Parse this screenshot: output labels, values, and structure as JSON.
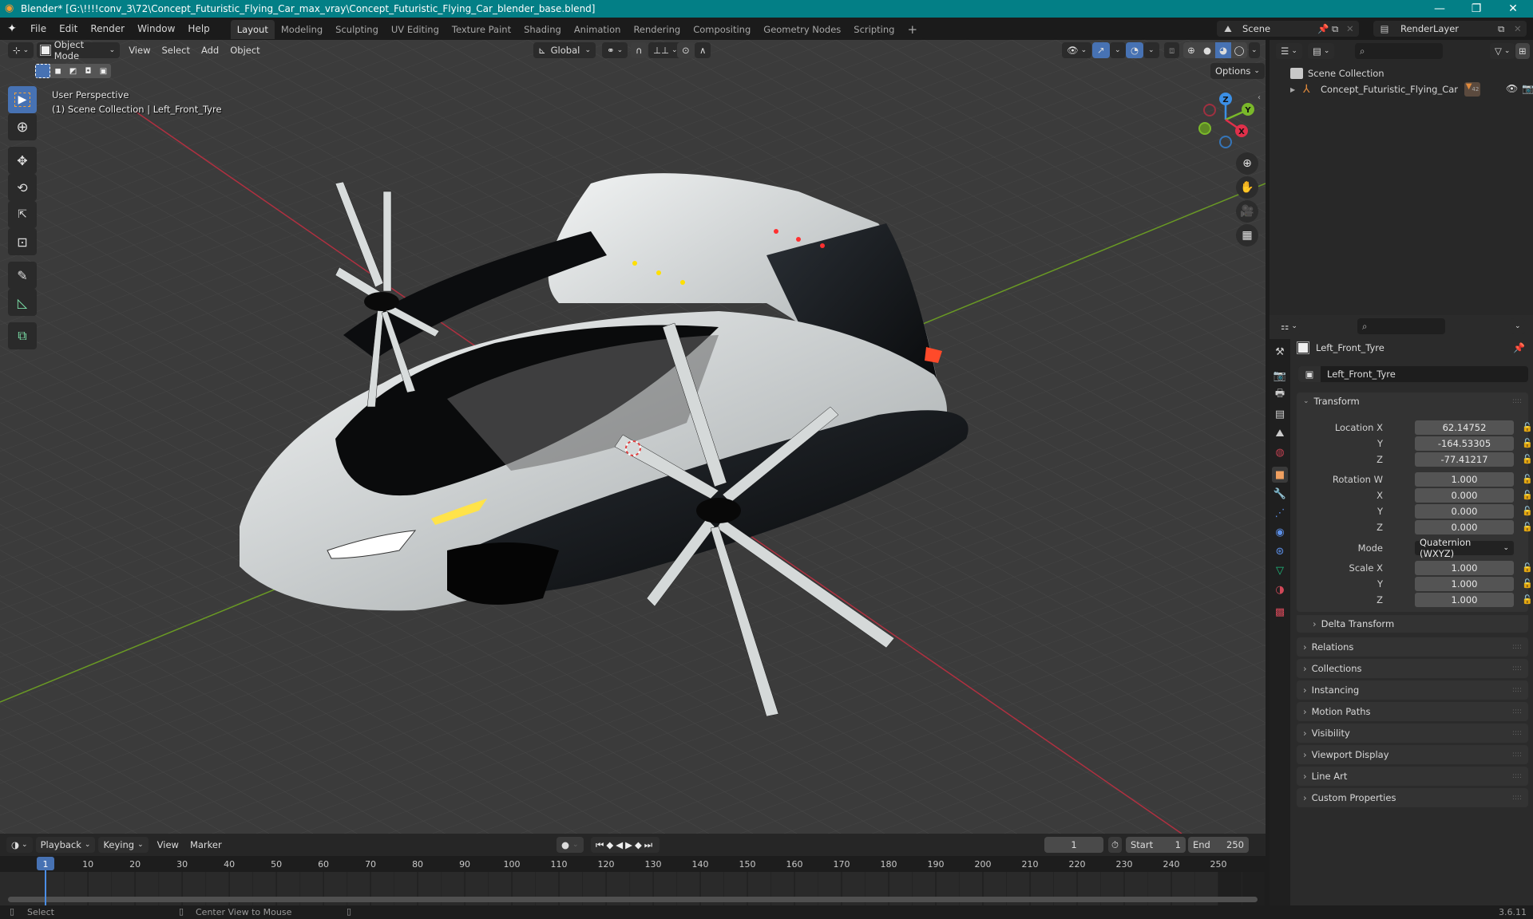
{
  "window": {
    "title": "Blender* [G:\\!!!!conv_3\\72\\Concept_Futuristic_Flying_Car_max_vray\\Concept_Futuristic_Flying_Car_blender_base.blend]",
    "controls": {
      "minimize": "—",
      "maximize": "❐",
      "close": "✕"
    }
  },
  "menubar": {
    "menus": [
      "File",
      "Edit",
      "Render",
      "Window",
      "Help"
    ],
    "workspaces": [
      "Layout",
      "Modeling",
      "Sculpting",
      "UV Editing",
      "Texture Paint",
      "Shading",
      "Animation",
      "Rendering",
      "Compositing",
      "Geometry Nodes",
      "Scripting"
    ],
    "active_workspace": "Layout",
    "add_workspace": "+",
    "scene": "Scene",
    "view_layer": "RenderLayer"
  },
  "viewport": {
    "mode": "Object Mode",
    "menus": [
      "View",
      "Select",
      "Add",
      "Object"
    ],
    "transform_orientation": "Global",
    "options_label": "Options",
    "overlay_title": "User Perspective",
    "overlay_subtitle": "(1) Scene Collection | Left_Front_Tyre",
    "gizmo_axes": {
      "z": "Z",
      "y": "Y",
      "x": "X"
    },
    "colors": {
      "x_axis": "#e0304a",
      "y_axis": "#7ab82a",
      "z_axis": "#3b8fe6",
      "accent": "#4772b3"
    },
    "tools": [
      "select-box",
      "cursor",
      "move",
      "rotate",
      "scale",
      "transform",
      "annotate",
      "measure",
      "add-cube"
    ]
  },
  "outliner": {
    "search_placeholder": "",
    "root": "Scene Collection",
    "items": [
      {
        "name": "Concept_Futuristic_Flying_Car",
        "badge": "42"
      }
    ]
  },
  "properties": {
    "object_name": "Left_Front_Tyre",
    "datablock_name": "Left_Front_Tyre",
    "transform_label": "Transform",
    "location": {
      "label": "Location X",
      "x": "62.14752",
      "y": "-164.53305",
      "z": "-77.41217"
    },
    "rotation": {
      "label": "Rotation W",
      "w": "1.000",
      "x": "0.000",
      "y": "0.000",
      "z": "0.000"
    },
    "mode_label": "Mode",
    "mode_value": "Quaternion (WXYZ)",
    "scale": {
      "label": "Scale X",
      "x": "1.000",
      "y": "1.000",
      "z": "1.000"
    },
    "axis_labels": {
      "x": "X",
      "y": "Y",
      "z": "Z"
    },
    "delta_transform": "Delta Transform",
    "sections": [
      "Relations",
      "Collections",
      "Instancing",
      "Motion Paths",
      "Visibility",
      "Viewport Display",
      "Line Art",
      "Custom Properties"
    ]
  },
  "timeline": {
    "menus": [
      "Playback",
      "Keying",
      "View",
      "Marker"
    ],
    "current_frame": "1",
    "start_label": "Start",
    "start": "1",
    "end_label": "End",
    "end": "250",
    "ticks": [
      "10",
      "20",
      "30",
      "40",
      "50",
      "60",
      "70",
      "80",
      "90",
      "100",
      "110",
      "120",
      "130",
      "140",
      "150",
      "160",
      "170",
      "180",
      "190",
      "200",
      "210",
      "220",
      "230",
      "240",
      "250"
    ],
    "playhead_label": "1"
  },
  "statusbar": {
    "select": "Select",
    "center_view": "Center View to Mouse",
    "version": "3.6.11"
  }
}
